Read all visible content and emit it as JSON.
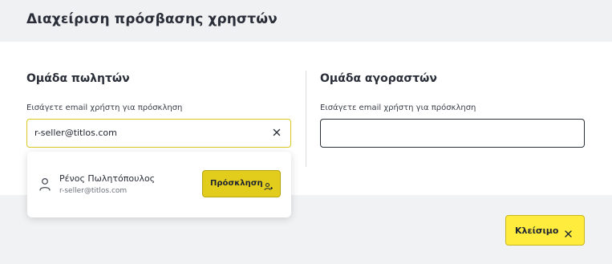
{
  "header": {
    "title": "Διαχείριση πρόσβασης χρηστών"
  },
  "sellers": {
    "title": "Ομάδα πωλητών",
    "label": "Εισάγετε email χρήστη για πρόσκληση",
    "value": "r-seller@titlos.com"
  },
  "buyers": {
    "title": "Ομάδα αγοραστών",
    "label": "Εισάγετε email χρήστη για πρόσκληση",
    "value": ""
  },
  "suggestion": {
    "name": "Ρένος Πωλητόπουλος",
    "email": "r-seller@titlos.com",
    "invite_label": "Πρόσκληση",
    "icon": "user-icon"
  },
  "footer": {
    "close_label": "Κλείσιμο"
  },
  "colors": {
    "accent": "#ffec3d",
    "invite": "#e2cc1c",
    "focus_border": "#d9c81f"
  }
}
